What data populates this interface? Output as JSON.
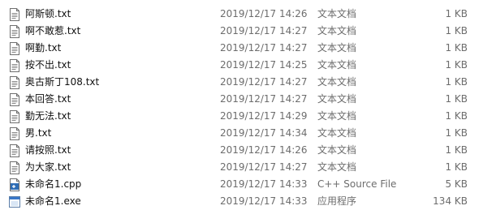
{
  "files": [
    {
      "name": "阿斯顿.txt",
      "date": "2019/12/17 14:26",
      "type": "文本文档",
      "size": "1 KB",
      "icon": "text-file-icon"
    },
    {
      "name": "啊不敢惹.txt",
      "date": "2019/12/17 14:27",
      "type": "文本文档",
      "size": "1 KB",
      "icon": "text-file-icon"
    },
    {
      "name": "啊勤.txt",
      "date": "2019/12/17 14:27",
      "type": "文本文档",
      "size": "1 KB",
      "icon": "text-file-icon"
    },
    {
      "name": "按不出.txt",
      "date": "2019/12/17 14:25",
      "type": "文本文档",
      "size": "1 KB",
      "icon": "text-file-icon"
    },
    {
      "name": "奥古斯丁108.txt",
      "date": "2019/12/17 14:27",
      "type": "文本文档",
      "size": "1 KB",
      "icon": "text-file-icon"
    },
    {
      "name": "本回答.txt",
      "date": "2019/12/17 14:27",
      "type": "文本文档",
      "size": "1 KB",
      "icon": "text-file-icon"
    },
    {
      "name": "勤无法.txt",
      "date": "2019/12/17 14:29",
      "type": "文本文档",
      "size": "1 KB",
      "icon": "text-file-icon"
    },
    {
      "name": "男.txt",
      "date": "2019/12/17 14:34",
      "type": "文本文档",
      "size": "1 KB",
      "icon": "text-file-icon"
    },
    {
      "name": "请按照.txt",
      "date": "2019/12/17 14:26",
      "type": "文本文档",
      "size": "1 KB",
      "icon": "text-file-icon"
    },
    {
      "name": "为大家.txt",
      "date": "2019/12/17 14:27",
      "type": "文本文档",
      "size": "1 KB",
      "icon": "text-file-icon"
    },
    {
      "name": "未命名1.cpp",
      "date": "2019/12/17 14:33",
      "type": "C++ Source File",
      "size": "5 KB",
      "icon": "cpp-file-icon"
    },
    {
      "name": "未命名1.exe",
      "date": "2019/12/17 14:33",
      "type": "应用程序",
      "size": "134 KB",
      "icon": "exe-file-icon"
    }
  ]
}
